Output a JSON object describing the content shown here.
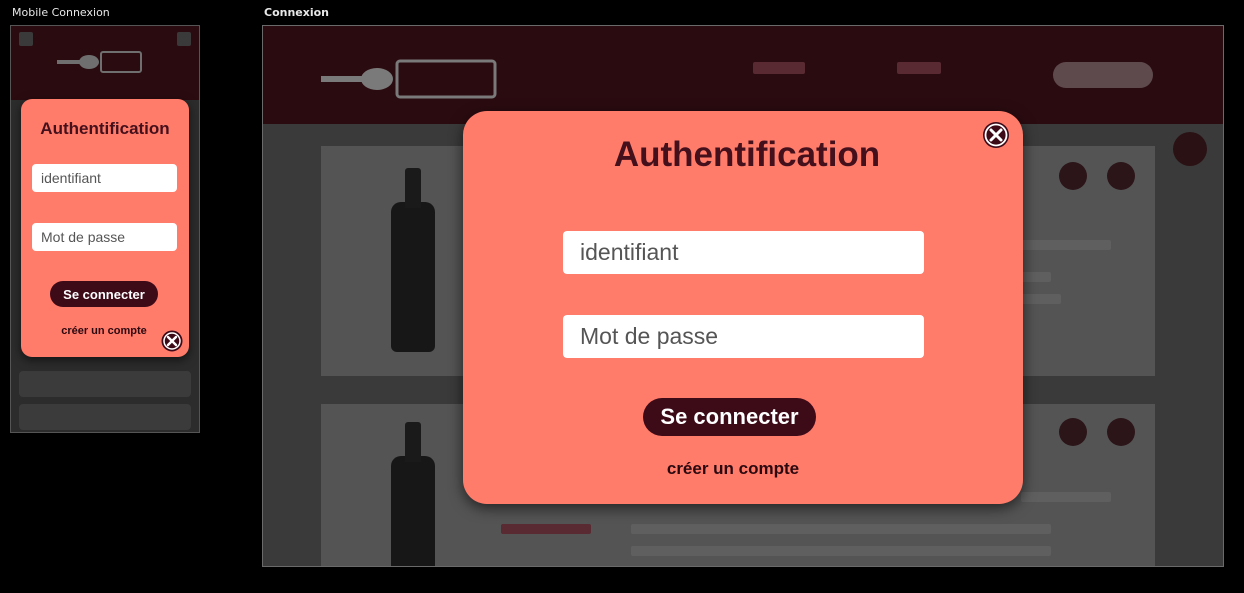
{
  "frames": {
    "mobile_label": "Mobile Connexion",
    "desktop_label": "Connexion"
  },
  "auth": {
    "title": "Authentification",
    "username_placeholder": "identifiant",
    "password_placeholder": "Mot de passe",
    "login_label": "Se connecter",
    "create_account_label": "créer un compte"
  },
  "colors": {
    "modal_bg": "#ff7b6a",
    "brand_dark": "#3d0a18",
    "header_bg": "#2a0b10"
  },
  "icons": {
    "close": "close-icon",
    "logo": "logo-icon"
  }
}
